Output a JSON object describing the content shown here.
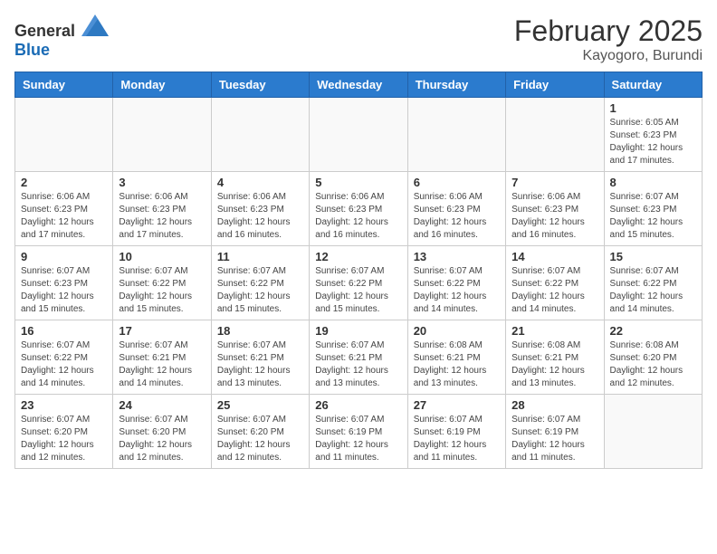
{
  "logo": {
    "general": "General",
    "blue": "Blue"
  },
  "header": {
    "month": "February 2025",
    "location": "Kayogoro, Burundi"
  },
  "weekdays": [
    "Sunday",
    "Monday",
    "Tuesday",
    "Wednesday",
    "Thursday",
    "Friday",
    "Saturday"
  ],
  "weeks": [
    [
      {
        "day": "",
        "info": ""
      },
      {
        "day": "",
        "info": ""
      },
      {
        "day": "",
        "info": ""
      },
      {
        "day": "",
        "info": ""
      },
      {
        "day": "",
        "info": ""
      },
      {
        "day": "",
        "info": ""
      },
      {
        "day": "1",
        "info": "Sunrise: 6:05 AM\nSunset: 6:23 PM\nDaylight: 12 hours and 17 minutes."
      }
    ],
    [
      {
        "day": "2",
        "info": "Sunrise: 6:06 AM\nSunset: 6:23 PM\nDaylight: 12 hours and 17 minutes."
      },
      {
        "day": "3",
        "info": "Sunrise: 6:06 AM\nSunset: 6:23 PM\nDaylight: 12 hours and 17 minutes."
      },
      {
        "day": "4",
        "info": "Sunrise: 6:06 AM\nSunset: 6:23 PM\nDaylight: 12 hours and 16 minutes."
      },
      {
        "day": "5",
        "info": "Sunrise: 6:06 AM\nSunset: 6:23 PM\nDaylight: 12 hours and 16 minutes."
      },
      {
        "day": "6",
        "info": "Sunrise: 6:06 AM\nSunset: 6:23 PM\nDaylight: 12 hours and 16 minutes."
      },
      {
        "day": "7",
        "info": "Sunrise: 6:06 AM\nSunset: 6:23 PM\nDaylight: 12 hours and 16 minutes."
      },
      {
        "day": "8",
        "info": "Sunrise: 6:07 AM\nSunset: 6:23 PM\nDaylight: 12 hours and 15 minutes."
      }
    ],
    [
      {
        "day": "9",
        "info": "Sunrise: 6:07 AM\nSunset: 6:23 PM\nDaylight: 12 hours and 15 minutes."
      },
      {
        "day": "10",
        "info": "Sunrise: 6:07 AM\nSunset: 6:22 PM\nDaylight: 12 hours and 15 minutes."
      },
      {
        "day": "11",
        "info": "Sunrise: 6:07 AM\nSunset: 6:22 PM\nDaylight: 12 hours and 15 minutes."
      },
      {
        "day": "12",
        "info": "Sunrise: 6:07 AM\nSunset: 6:22 PM\nDaylight: 12 hours and 15 minutes."
      },
      {
        "day": "13",
        "info": "Sunrise: 6:07 AM\nSunset: 6:22 PM\nDaylight: 12 hours and 14 minutes."
      },
      {
        "day": "14",
        "info": "Sunrise: 6:07 AM\nSunset: 6:22 PM\nDaylight: 12 hours and 14 minutes."
      },
      {
        "day": "15",
        "info": "Sunrise: 6:07 AM\nSunset: 6:22 PM\nDaylight: 12 hours and 14 minutes."
      }
    ],
    [
      {
        "day": "16",
        "info": "Sunrise: 6:07 AM\nSunset: 6:22 PM\nDaylight: 12 hours and 14 minutes."
      },
      {
        "day": "17",
        "info": "Sunrise: 6:07 AM\nSunset: 6:21 PM\nDaylight: 12 hours and 14 minutes."
      },
      {
        "day": "18",
        "info": "Sunrise: 6:07 AM\nSunset: 6:21 PM\nDaylight: 12 hours and 13 minutes."
      },
      {
        "day": "19",
        "info": "Sunrise: 6:07 AM\nSunset: 6:21 PM\nDaylight: 12 hours and 13 minutes."
      },
      {
        "day": "20",
        "info": "Sunrise: 6:08 AM\nSunset: 6:21 PM\nDaylight: 12 hours and 13 minutes."
      },
      {
        "day": "21",
        "info": "Sunrise: 6:08 AM\nSunset: 6:21 PM\nDaylight: 12 hours and 13 minutes."
      },
      {
        "day": "22",
        "info": "Sunrise: 6:08 AM\nSunset: 6:20 PM\nDaylight: 12 hours and 12 minutes."
      }
    ],
    [
      {
        "day": "23",
        "info": "Sunrise: 6:07 AM\nSunset: 6:20 PM\nDaylight: 12 hours and 12 minutes."
      },
      {
        "day": "24",
        "info": "Sunrise: 6:07 AM\nSunset: 6:20 PM\nDaylight: 12 hours and 12 minutes."
      },
      {
        "day": "25",
        "info": "Sunrise: 6:07 AM\nSunset: 6:20 PM\nDaylight: 12 hours and 12 minutes."
      },
      {
        "day": "26",
        "info": "Sunrise: 6:07 AM\nSunset: 6:19 PM\nDaylight: 12 hours and 11 minutes."
      },
      {
        "day": "27",
        "info": "Sunrise: 6:07 AM\nSunset: 6:19 PM\nDaylight: 12 hours and 11 minutes."
      },
      {
        "day": "28",
        "info": "Sunrise: 6:07 AM\nSunset: 6:19 PM\nDaylight: 12 hours and 11 minutes."
      },
      {
        "day": "",
        "info": ""
      }
    ]
  ]
}
